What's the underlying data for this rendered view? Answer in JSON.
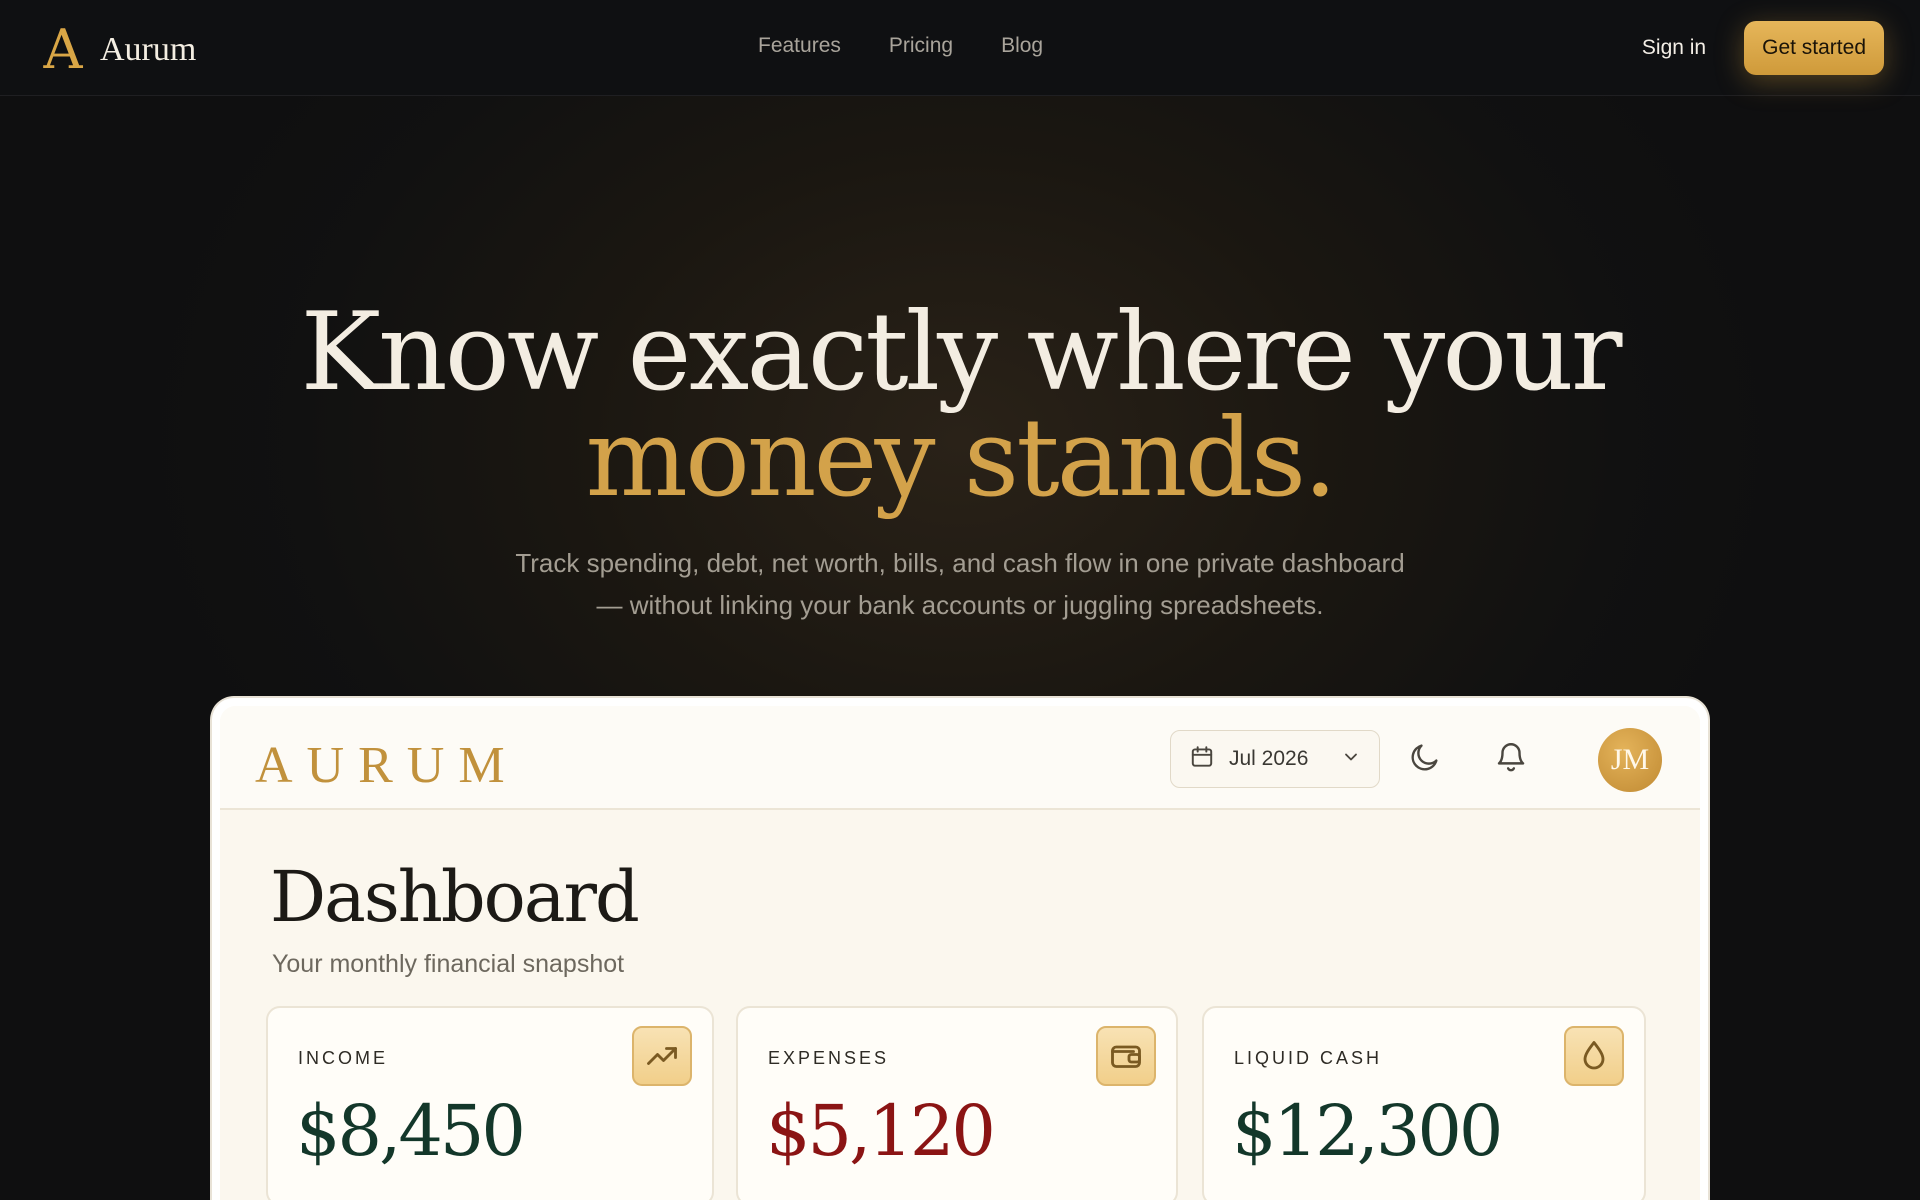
{
  "nav": {
    "brand_mark": "A",
    "brand_name": "Aurum",
    "links": [
      "Features",
      "Pricing",
      "Blog"
    ],
    "signin_label": "Sign in",
    "cta_label": "Get started"
  },
  "hero": {
    "line1": "Know exactly where your",
    "line2": "money stands.",
    "sub_line1": "Track spending, debt, net worth, bills, and cash flow in one private dashboard",
    "sub_line2": "— without linking your bank accounts or juggling spreadsheets."
  },
  "preview": {
    "logo": "AURUM",
    "date": "Jul 2026",
    "avatar_initials": "JM",
    "title": "Dashboard",
    "subtitle": "Your monthly financial snapshot",
    "cards": [
      {
        "label": "INCOME",
        "value": "$8,450",
        "icon": "trending-up-icon",
        "color": "#13372a"
      },
      {
        "label": "EXPENSES",
        "value": "$5,120",
        "icon": "wallet-icon",
        "color": "#8b1414"
      },
      {
        "label": "LIQUID CASH",
        "value": "$12,300",
        "icon": "droplet-icon",
        "color": "#13372a"
      }
    ]
  },
  "colors": {
    "accent": "#d3a24a",
    "background": "#0f0f10",
    "income": "#13372a",
    "expense": "#8b1414"
  }
}
